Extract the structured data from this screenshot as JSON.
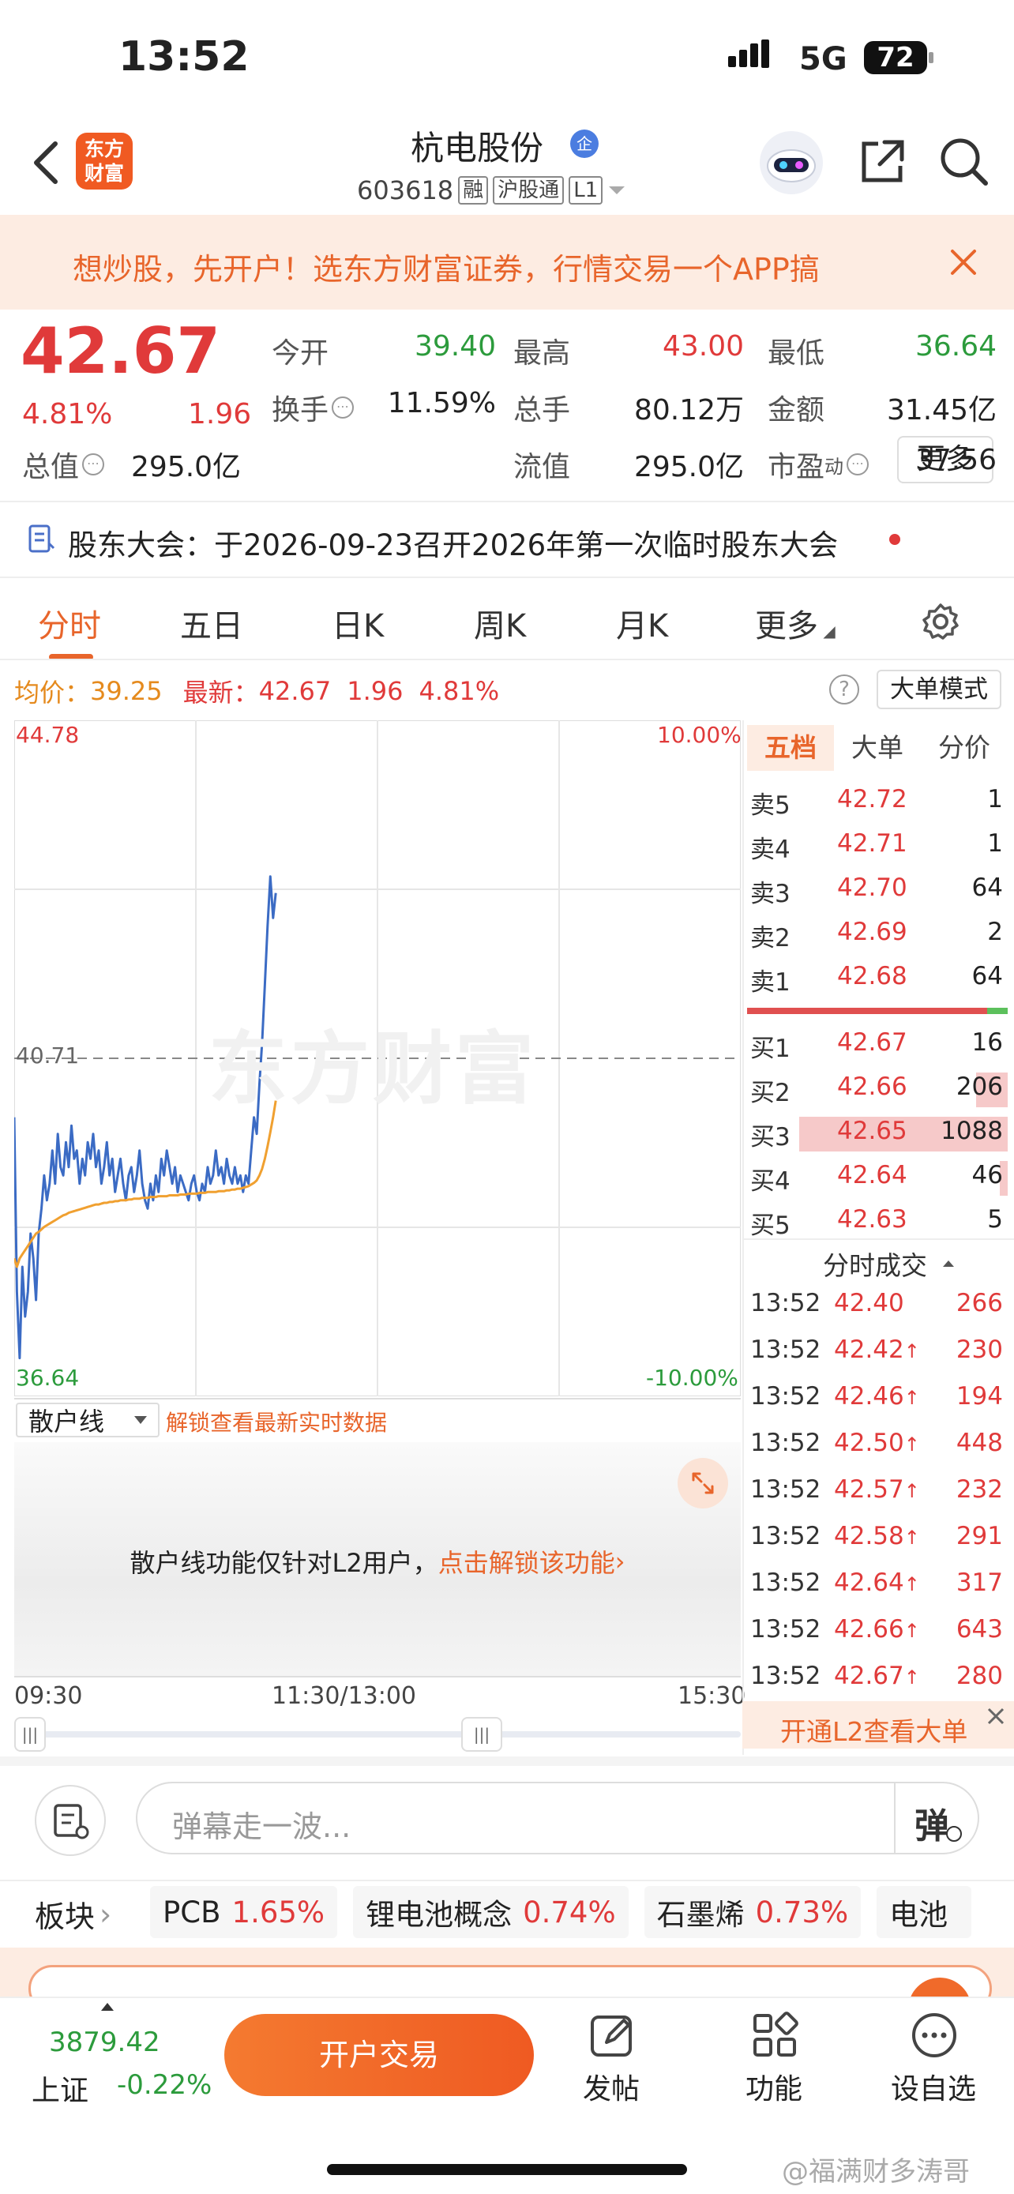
{
  "status": {
    "time": "13:52",
    "network": "5G",
    "battery": "72"
  },
  "header": {
    "title": "杭电股份",
    "code": "603618",
    "tags": [
      "融",
      "沪股通",
      "L1"
    ],
    "logo_line1": "东方",
    "logo_line2": "财富",
    "badge": "企"
  },
  "banner": {
    "text": "想炒股，先开户！选东方财富证券，行情交易一个APP搞"
  },
  "quote": {
    "price": "42.67",
    "pct": "4.81%",
    "chg": "1.96",
    "fields": [
      {
        "label": "今开",
        "value": "39.40",
        "cls": "green"
      },
      {
        "label": "最高",
        "value": "43.00",
        "cls": "red"
      },
      {
        "label": "最低",
        "value": "36.64",
        "cls": "green"
      },
      {
        "label": "换手",
        "value": "11.59%",
        "cls": ""
      },
      {
        "label": "总手",
        "value": "80.12万",
        "cls": ""
      },
      {
        "label": "金额",
        "value": "31.45亿",
        "cls": ""
      },
      {
        "label": "总值",
        "value": "295.0亿",
        "cls": ""
      },
      {
        "label": "流值",
        "value": "295.0亿",
        "cls": ""
      },
      {
        "label": "市盈",
        "value": "37.56",
        "cls": ""
      }
    ],
    "pe_suffix": "动",
    "more": "更多"
  },
  "notice": {
    "text": "股东大会：于2026-09-23召开2026年第一次临时股东大会"
  },
  "tabs": [
    "分时",
    "五日",
    "日K",
    "周K",
    "月K",
    "更多"
  ],
  "chart_info": {
    "avg_label": "均价：",
    "avg": "39.25",
    "latest_label": "最新：",
    "latest": "42.67",
    "chg": "1.96",
    "pct": "4.81%",
    "mode_btn": "大单模式",
    "watermark": "东方财富"
  },
  "chart_data": {
    "type": "line",
    "y_axis": {
      "max": "44.78",
      "min": "36.64",
      "ref": "40.71",
      "max_pct": "10.00%",
      "min_pct": "-10.00%",
      "ylim": [
        36.64,
        44.78
      ]
    },
    "x_labels": [
      "09:30",
      "11:30/13:00",
      "15:30"
    ],
    "series": [
      {
        "color": "#3b6bc4",
        "values": [
          40.0,
          37.9,
          37.1,
          38.2,
          37.6,
          37.9,
          38.6,
          38.3,
          37.8,
          38.6,
          38.9,
          39.3,
          39.0,
          39.2,
          39.6,
          39.2,
          39.8,
          39.4,
          39.3,
          39.7,
          39.4,
          39.9,
          39.5,
          39.6,
          39.2,
          39.5,
          39.3,
          39.7,
          39.5,
          39.8,
          39.4,
          39.6,
          39.2,
          39.4,
          39.7,
          39.3,
          39.5,
          39.1,
          39.3,
          39.5,
          39.2,
          39.0,
          39.3,
          39.4,
          39.1,
          39.3,
          39.6,
          39.2,
          39.0,
          38.9,
          39.2,
          39.0,
          39.3,
          39.1,
          39.5,
          39.3,
          39.6,
          39.4,
          39.2,
          39.4,
          39.1,
          39.3,
          39.2,
          39.1,
          39.0,
          39.2,
          39.3,
          39.1,
          39.0,
          39.2,
          39.1,
          39.4,
          39.2,
          39.3,
          39.6,
          39.3,
          39.4,
          39.2,
          39.5,
          39.3,
          39.2,
          39.4,
          39.2,
          39.3,
          39.1,
          39.3,
          39.2,
          39.6,
          40.0,
          39.8,
          40.4,
          40.9,
          41.6,
          42.3,
          42.9,
          42.4,
          42.7
        ],
        "name": ""
      },
      {
        "color": "#f0a030",
        "values": [
          38.3,
          38.2,
          38.3,
          38.35,
          38.4,
          38.45,
          38.5,
          38.55,
          38.6,
          38.62,
          38.65,
          38.68,
          38.7,
          38.72,
          38.74,
          38.76,
          38.78,
          38.8,
          38.82,
          38.83,
          38.85,
          38.86,
          38.87,
          38.88,
          38.89,
          38.9,
          38.91,
          38.92,
          38.93,
          38.94,
          38.95,
          38.95,
          38.96,
          38.97,
          38.97,
          38.98,
          38.98,
          38.99,
          38.99,
          39.0,
          39.0,
          39.0,
          39.01,
          39.01,
          39.02,
          39.02,
          39.02,
          39.03,
          39.03,
          39.03,
          39.04,
          39.04,
          39.04,
          39.05,
          39.05,
          39.05,
          39.05,
          39.06,
          39.06,
          39.06,
          39.06,
          39.07,
          39.07,
          39.07,
          39.08,
          39.08,
          39.08,
          39.08,
          39.09,
          39.09,
          39.09,
          39.1,
          39.1,
          39.1,
          39.1,
          39.11,
          39.11,
          39.11,
          39.12,
          39.12,
          39.13,
          39.13,
          39.14,
          39.14,
          39.15,
          39.16,
          39.17,
          39.19,
          39.21,
          39.24,
          39.3,
          39.38,
          39.5,
          39.65,
          39.82,
          40.0,
          40.2
        ],
        "name": ""
      }
    ]
  },
  "depth": {
    "tabs": [
      "五档",
      "大单",
      "分价"
    ],
    "sell": [
      {
        "label": "卖5",
        "price": "42.72",
        "vol": "1"
      },
      {
        "label": "卖4",
        "price": "42.71",
        "vol": "1"
      },
      {
        "label": "卖3",
        "price": "42.70",
        "vol": "64"
      },
      {
        "label": "卖2",
        "price": "42.69",
        "vol": "2"
      },
      {
        "label": "卖1",
        "price": "42.68",
        "vol": "64"
      }
    ],
    "buy": [
      {
        "label": "买1",
        "price": "42.67",
        "vol": "16"
      },
      {
        "label": "买2",
        "price": "42.66",
        "vol": "206"
      },
      {
        "label": "买3",
        "price": "42.65",
        "vol": "1088"
      },
      {
        "label": "买4",
        "price": "42.64",
        "vol": "46"
      },
      {
        "label": "买5",
        "price": "42.63",
        "vol": "5"
      }
    ],
    "buy_fill": [
      0,
      0.12,
      0.8,
      0.03,
      0
    ],
    "trades_title": "分时成交",
    "trades": [
      {
        "t": "13:52",
        "p": "42.40",
        "a": "",
        "v": "266"
      },
      {
        "t": "13:52",
        "p": "42.42",
        "a": "↑",
        "v": "230"
      },
      {
        "t": "13:52",
        "p": "42.46",
        "a": "↑",
        "v": "194"
      },
      {
        "t": "13:52",
        "p": "42.50",
        "a": "↑",
        "v": "448"
      },
      {
        "t": "13:52",
        "p": "42.57",
        "a": "↑",
        "v": "232"
      },
      {
        "t": "13:52",
        "p": "42.58",
        "a": "↑",
        "v": "291"
      },
      {
        "t": "13:52",
        "p": "42.64",
        "a": "↑",
        "v": "317"
      },
      {
        "t": "13:52",
        "p": "42.66",
        "a": "↑",
        "v": "643"
      },
      {
        "t": "13:52",
        "p": "42.67",
        "a": "↑",
        "v": "280"
      }
    ],
    "l2_banner": "开通L2查看大单"
  },
  "sub": {
    "select": "散户线",
    "unlock": "解锁查看最新实时数据",
    "msg": "散户线功能仅针对L2用户，",
    "link": "点击解锁该功能"
  },
  "danmu": {
    "placeholder": "弹幕走一波...",
    "btn": "弹"
  },
  "sectors": {
    "label": "板块",
    "items": [
      {
        "name": "PCB",
        "pct": "1.65%"
      },
      {
        "name": "锂电池概念",
        "pct": "0.74%"
      },
      {
        "name": "石墨烯",
        "pct": "0.73%"
      },
      {
        "name": "电池",
        "pct": ""
      }
    ]
  },
  "bottom": {
    "index_value": "3879.42",
    "index_name": "上证",
    "index_pct": "-0.22%",
    "trade_btn": "开户交易",
    "nav": [
      "发帖",
      "功能",
      "设自选"
    ]
  },
  "watermark": "@福满财多涛哥"
}
